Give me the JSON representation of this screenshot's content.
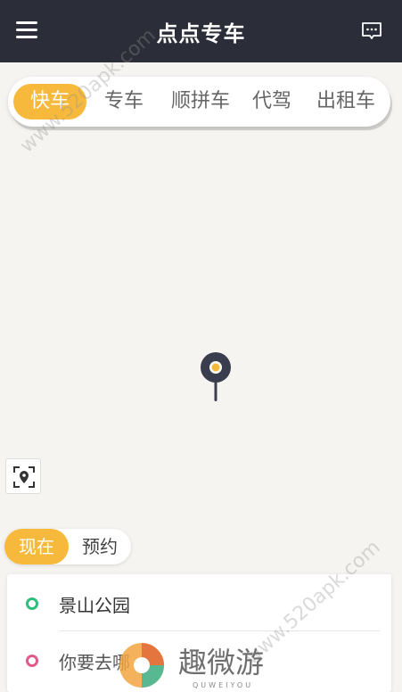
{
  "header": {
    "title": "点点专车",
    "menu_icon": "hamburger-menu-icon",
    "message_icon": "message-icon"
  },
  "tabs": [
    {
      "label": "快车",
      "active": true
    },
    {
      "label": "专车",
      "active": false
    },
    {
      "label": "顺拼车",
      "active": false
    },
    {
      "label": "代驾",
      "active": false
    },
    {
      "label": "出租车",
      "active": false
    }
  ],
  "toggle": {
    "now": "现在",
    "reserve": "预约"
  },
  "route": {
    "from": {
      "text": "景山公园",
      "color": "#2ebd7a"
    },
    "to": {
      "text": "你要去哪",
      "color": "#e05a8a"
    }
  },
  "colors": {
    "accent": "#f6b93b",
    "header": "#2b2d38"
  },
  "watermarks": [
    "www.520apk.com",
    "www.520apk.com"
  ],
  "logo": {
    "name": "趣微游",
    "sub": "QUWEIYOU"
  }
}
